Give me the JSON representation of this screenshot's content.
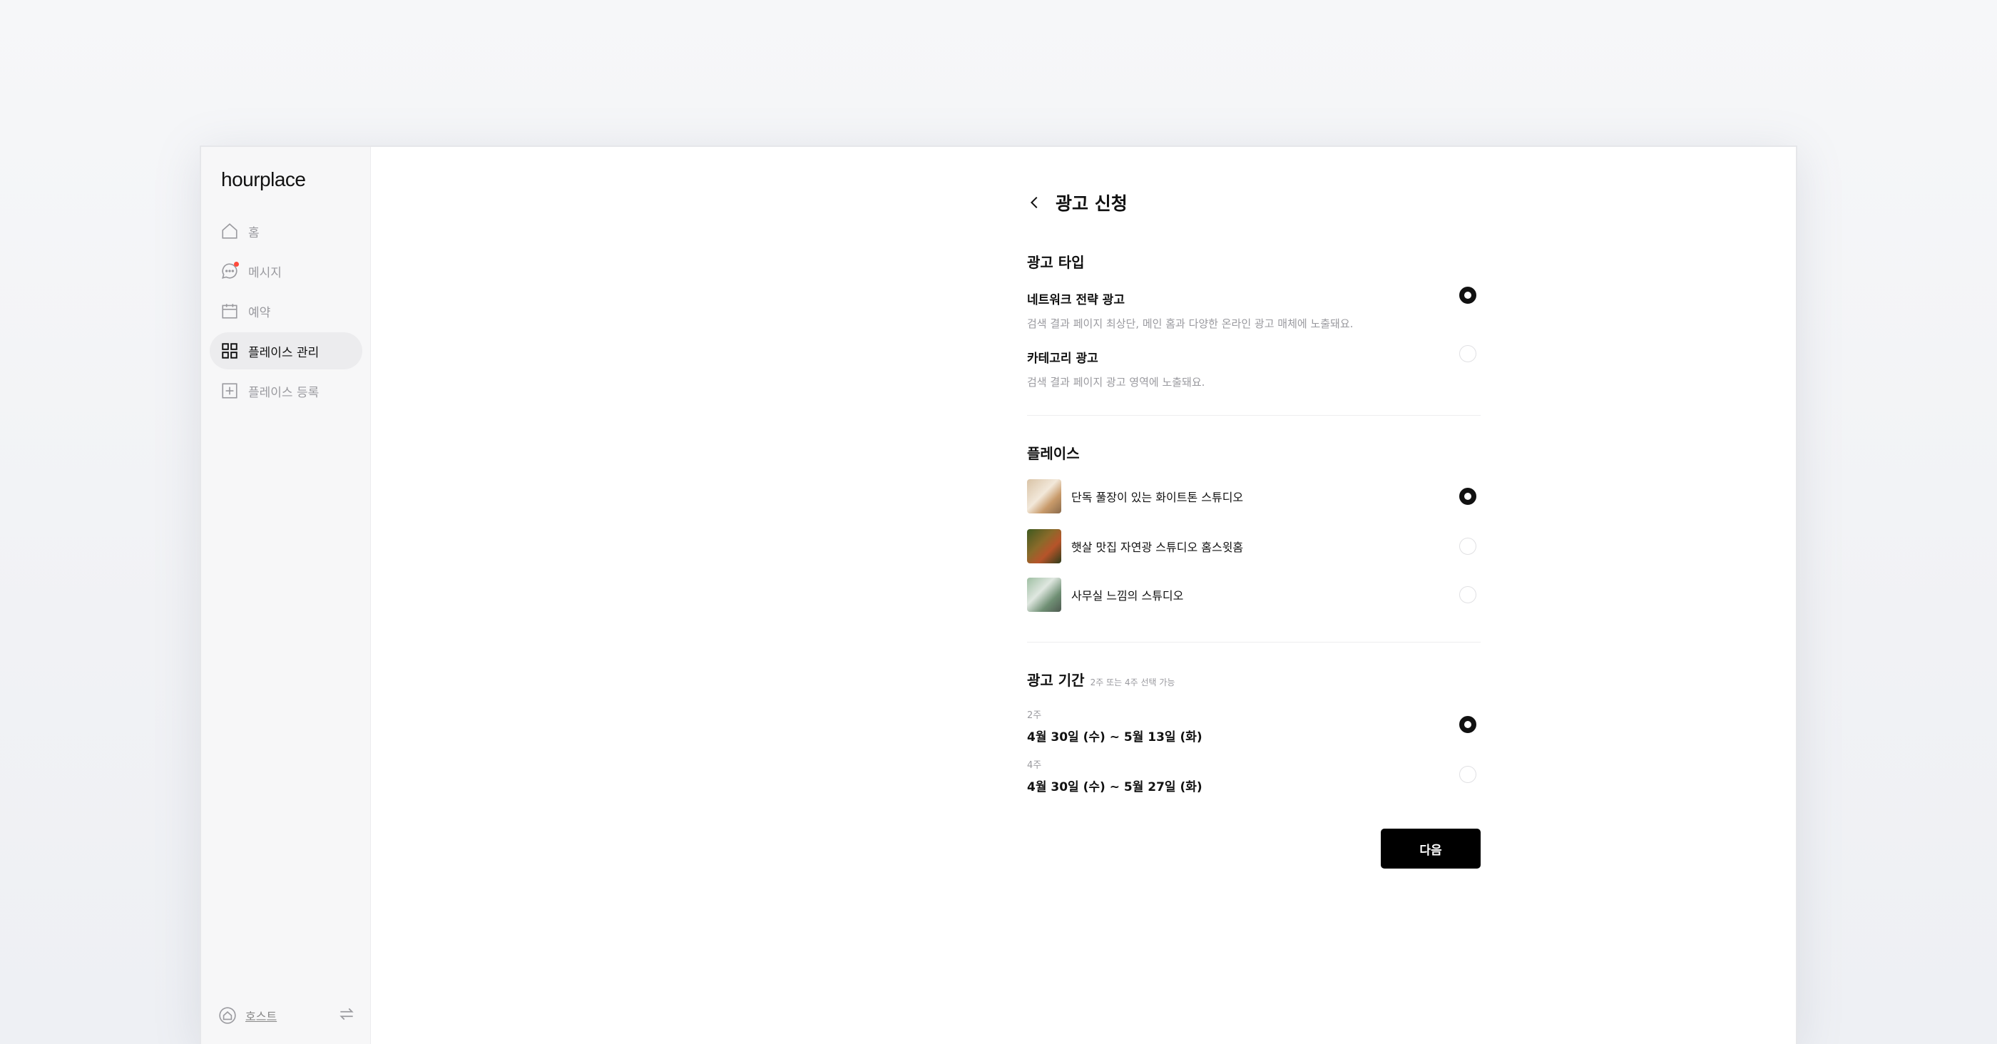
{
  "app": {
    "logo": "hourplace"
  },
  "sidebar": {
    "items": [
      {
        "label": "홈",
        "icon": "home-icon"
      },
      {
        "label": "메시지",
        "icon": "message-icon"
      },
      {
        "label": "예약",
        "icon": "calendar-icon"
      },
      {
        "label": "플레이스 관리",
        "icon": "grid-icon",
        "active": true
      },
      {
        "label": "플레이스 등록",
        "icon": "plus-square-icon"
      }
    ],
    "footer": {
      "host_label": "호스트",
      "host_icon": "host-icon",
      "switch_icon": "switch-icon"
    }
  },
  "page": {
    "title": "광고 신청",
    "back_icon": "chevron-left-icon"
  },
  "ad_type": {
    "title": "광고 타입",
    "options": [
      {
        "title": "네트워크 전략 광고",
        "desc": "검색 결과 페이지 최상단, 메인 홈과 다양한 온라인 광고 매체에 노출돼요.",
        "selected": true
      },
      {
        "title": "카테고리 광고",
        "desc": "검색 결과 페이지 광고 영역에 노출돼요.",
        "selected": false
      }
    ]
  },
  "places": {
    "title": "플레이스",
    "items": [
      {
        "name": "단독 풀장이 있는 화이트톤 스튜디오",
        "selected": true
      },
      {
        "name": "햇살 맛집 자연광 스튜디오 홈스윗홈",
        "selected": false
      },
      {
        "name": "사무실 느낌의 스튜디오",
        "selected": false
      }
    ]
  },
  "period": {
    "title": "광고 기간",
    "hint": "2주 또는 4주 선택 가능",
    "options": [
      {
        "label": "2주",
        "range": "4월 30일 (수) ~ 5월 13일 (화)",
        "selected": true
      },
      {
        "label": "4주",
        "range": "4월 30일 (수) ~ 5월 27일 (화)",
        "selected": false
      }
    ]
  },
  "actions": {
    "next_label": "다음"
  },
  "colors": {
    "accent": "#000000",
    "muted": "#9a9a9f",
    "badge": "#ff4a3b"
  }
}
